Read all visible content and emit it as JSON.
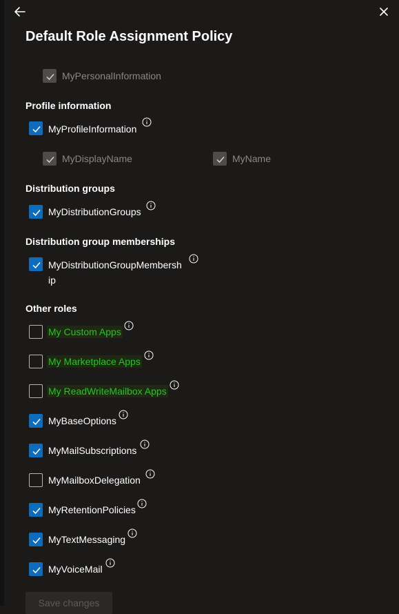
{
  "panel": {
    "title": "Default Role Assignment Policy",
    "save_label": "Save changes"
  },
  "sections": {
    "profile": "Profile information",
    "distribution_groups": "Distribution groups",
    "distribution_memberships": "Distribution group memberships",
    "other_roles": "Other roles"
  },
  "roles": {
    "my_personal_information": {
      "label": "MyPersonalInformation",
      "checked": true,
      "disabled": true
    },
    "my_profile_information": {
      "label": "MyProfileInformation",
      "checked": true
    },
    "my_display_name": {
      "label": "MyDisplayName",
      "checked": true,
      "disabled": true
    },
    "my_name": {
      "label": "MyName",
      "checked": true,
      "disabled": true
    },
    "my_distribution_groups": {
      "label": "MyDistributionGroups",
      "checked": true
    },
    "my_distribution_group_membership": {
      "label": "MyDistributionGroupMembersh ip",
      "checked": true
    },
    "my_custom_apps": {
      "label": "My Custom Apps",
      "checked": false
    },
    "my_marketplace_apps": {
      "label": "My Marketplace Apps",
      "checked": false
    },
    "my_readwritemailbox_apps": {
      "label": "My ReadWriteMailbox Apps",
      "checked": false
    },
    "my_base_options": {
      "label": "MyBaseOptions",
      "checked": true
    },
    "my_mail_subscriptions": {
      "label": "MyMailSubscriptions",
      "checked": true
    },
    "my_mailbox_delegation": {
      "label": "MyMailboxDelegation",
      "checked": false
    },
    "my_retention_policies": {
      "label": "MyRetentionPolicies",
      "checked": true
    },
    "my_text_messaging": {
      "label": "MyTextMessaging",
      "checked": true
    },
    "my_voice_mail": {
      "label": "MyVoiceMail",
      "checked": true
    }
  },
  "icons": {
    "back": "arrow-left-icon",
    "close": "close-icon",
    "info": "info-icon",
    "check": "checkmark-icon"
  },
  "colors": {
    "background": "#1b1a19",
    "accent": "#0f6cbd",
    "highlight_text": "#20c820"
  }
}
